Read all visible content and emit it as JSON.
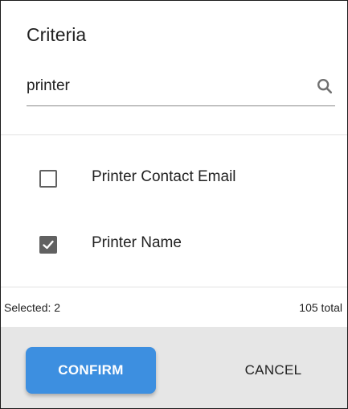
{
  "dialog": {
    "title": "Criteria"
  },
  "search": {
    "value": "printer",
    "icon": "search-icon"
  },
  "list": {
    "items": [
      {
        "label": "Printer Contact Email",
        "checked": false
      },
      {
        "label": "Printer Name",
        "checked": true
      }
    ]
  },
  "status": {
    "selected": "Selected: 2",
    "total": "105 total"
  },
  "footer": {
    "confirm_label": "CONFIRM",
    "cancel_label": "CANCEL"
  },
  "colors": {
    "accent": "#3d8fe0",
    "checkbox": "#616161",
    "footer_bg": "#e6e6e6"
  }
}
